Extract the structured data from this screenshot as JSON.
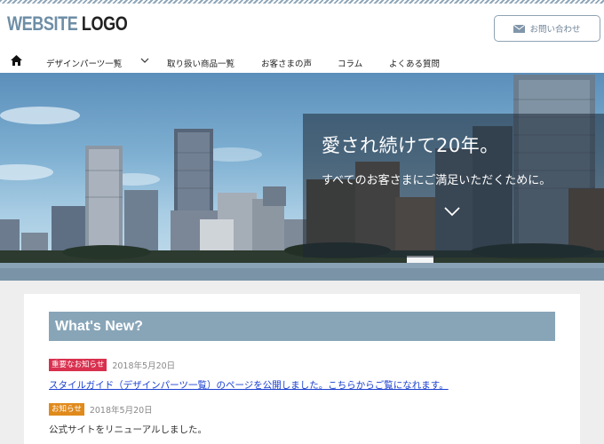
{
  "header": {
    "logo_part1": "WEBSITE",
    "logo_part2": "LOGO",
    "contact_button": "お問い合わせ",
    "icons": {
      "contact": "mail-icon",
      "home": "home-icon",
      "dropdown": "chevron-down-icon"
    }
  },
  "nav": {
    "items": [
      {
        "label": "デザインパーツ一覧"
      },
      {
        "label": "取り扱い商品一覧"
      },
      {
        "label": "お客さまの声"
      },
      {
        "label": "コラム"
      },
      {
        "label": "よくある質問"
      }
    ]
  },
  "hero": {
    "headline": "愛され続けて20年。",
    "subline": "すべてのお客さまにご満足いただくために。",
    "scroll_icon": "chevron-down-icon"
  },
  "whats_new": {
    "heading": "What's New?",
    "items": [
      {
        "badge": "重要なお知らせ",
        "badge_color": "#d9304f",
        "date": "2018年5月20日",
        "text": "スタイルガイド（デザインパーツ一覧）のページを公開しました。こちらからご覧になれます。",
        "is_link": true
      },
      {
        "badge": "お知らせ",
        "badge_color": "#e08a1c",
        "date": "2018年5月20日",
        "text": "公式サイトをリニューアルしました。",
        "is_link": false
      }
    ]
  },
  "colors": {
    "accent": "#88a5b8",
    "logo_website": "#6e8ea6",
    "link": "#1a3fd0"
  }
}
